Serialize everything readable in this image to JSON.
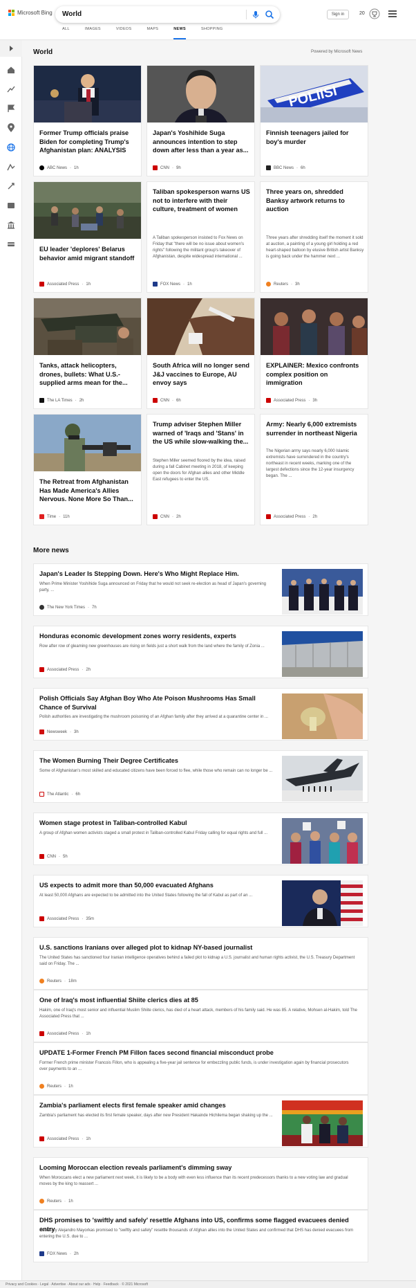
{
  "header": {
    "brand": "Microsoft Bing",
    "query": "World",
    "signin_label": "Sign in",
    "points": "20",
    "colors": {
      "red": "#f25022",
      "green": "#7fba00",
      "blue": "#00a4ef",
      "yellow": "#ffb900",
      "accent": "#1a73e8"
    }
  },
  "tabs": [
    "ALL",
    "IMAGES",
    "VIDEOS",
    "MAPS",
    "NEWS",
    "SHOPPING"
  ],
  "active_tab": "NEWS",
  "rail_icons": [
    "expand-icon",
    "home-icon",
    "trending-icon",
    "flag-icon",
    "location-icon",
    "globe-icon",
    "business-icon",
    "tech-icon",
    "entertainment-icon",
    "politics-icon",
    "money-icon"
  ],
  "section": {
    "title": "World",
    "powered": "Powered by Microsoft News"
  },
  "cards": [
    {
      "title": "Former Trump officials praise Biden for completing Trump's Afghanistan plan: ANALYSIS",
      "source": "ABC News",
      "age": "1h",
      "image": "photo"
    },
    {
      "title": "Japan's Yoshihide Suga announces intention to step down after less than a year as...",
      "source": "CNN",
      "age": "9h",
      "image": "photo"
    },
    {
      "title": "Finnish teenagers jailed for boy's murder",
      "source": "BBC News",
      "age": "6h",
      "image": "photo"
    },
    {
      "title": "EU leader 'deplores' Belarus behavior amid migrant standoff",
      "source": "Associated Press",
      "age": "1h",
      "image": "photo"
    },
    {
      "title": "Taliban spokesperson warns US not to interfere with their culture, treatment of women",
      "snippet": "A Taliban spokesperson insisted to Fox News on Friday that \"there will be no issue about women's rights\" following the militant group's takeover of Afghanistan, despite widespread international ...",
      "source": "FOX News",
      "age": "1h"
    },
    {
      "title": "Three years on, shredded Banksy artwork returns to auction",
      "snippet": "Three years after shredding itself the moment it sold at auction, a painting of a young girl holding a red heart-shaped balloon by elusive British artist Banksy is going back under the hammer next ...",
      "source": "Reuters",
      "age": "3h"
    },
    {
      "title": "Tanks, attack helicopters, drones, bullets: What U.S.-supplied arms mean for the...",
      "source": "The LA Times",
      "age": "2h",
      "image": "photo"
    },
    {
      "title": "South Africa will no longer send J&J vaccines to Europe, AU envoy says",
      "source": "CNN",
      "age": "6h",
      "image": "photo"
    },
    {
      "title": "EXPLAINER: Mexico confronts complex position on immigration",
      "source": "Associated Press",
      "age": "3h",
      "image": "photo"
    },
    {
      "title": "The Retreat from Afghanistan Has Made America's Allies Nervous. None More So Than...",
      "source": "Time",
      "age": "11h",
      "image": "photo"
    },
    {
      "title": "Trump adviser Stephen Miller warned of 'Iraqs and 'Stans' in the US while slow-walking the...",
      "snippet": "Stephen Miller seemed floored by the idea, raised during a fall Cabinet meeting in 2018, of keeping open the doors for Afghan allies and other Middle East refugees to enter the US.",
      "source": "CNN",
      "age": "2h"
    },
    {
      "title": "Army: Nearly 6,000 extremists surrender in northeast Nigeria",
      "snippet": "The Nigerian army says nearly 6,000 Islamic extremists have surrendered in the country's northeast in recent weeks, marking one of the largest defections since the 12-year insurgency began. The ...",
      "source": "Associated Press",
      "age": "2h"
    }
  ],
  "more_title": "More news",
  "rows": [
    {
      "title": "Japan's Leader Is Stepping Down. Here's Who Might Replace Him.",
      "snippet": "When Prime Minister Yoshihide Suga announced on Friday that he would not seek re-election as head of Japan's governing party, ...",
      "source": "The New York Times",
      "age": "7h"
    },
    {
      "title": "Honduras economic development zones worry residents, experts",
      "snippet": "Row after row of gleaming new greenhouses are rising on fields just a short walk from the land where the family of Zonia ...",
      "source": "Associated Press",
      "age": "2h"
    },
    {
      "title": "Polish Officials Say Afghan Boy Who Ate Poison Mushrooms Has Small Chance of Survival",
      "snippet": "Polish authorities are investigating the mushroom poisoning of an Afghan family after they arrived at a quarantine center in ...",
      "source": "Newsweek",
      "age": "3h"
    },
    {
      "title": "The Women Burning Their Degree Certificates",
      "snippet": "Some of Afghanistan's most skilled and educated citizens have been forced to flee, while those who remain can no longer be ...",
      "source": "The Atlantic",
      "age": "6h"
    },
    {
      "title": "Women stage protest in Taliban-controlled Kabul",
      "snippet": "A group of Afghan women activists staged a small protest in Taliban-controlled Kabul Friday calling for equal rights and full ...",
      "source": "CNN",
      "age": "5h"
    },
    {
      "title": "US expects to admit more than 50,000 evacuated Afghans",
      "snippet": "At least 50,000 Afghans are expected to be admitted into the United States following the fall of Kabul as part of an ...",
      "source": "Associated Press",
      "age": "35m"
    },
    {
      "title": "U.S. sanctions Iranians over alleged plot to kidnap NY-based journalist",
      "snippet": "The United States has sanctioned four Iranian intelligence operatives behind a failed plot to kidnap a U.S. journalist and human rights activist, the U.S. Treasury Department said on Friday. The ...",
      "source": "Reuters",
      "age": "18m"
    },
    {
      "title": "One of Iraq's most influential Shiite clerics dies at 85",
      "snippet": "Hakim, one of Iraq's most senior and influential Muslim Shiite clerics, has died of a heart attack, members of his family said. He was 85. A relative, Mohsen al-Hakim, told The Associated Press that ...",
      "source": "Associated Press",
      "age": "1h"
    },
    {
      "title": "UPDATE 1-Former French PM Fillon faces second financial misconduct probe",
      "snippet": "Former French prime minister Francois Fillon, who is appealing a five-year jail sentence for embezzling public funds, is under investigation again by financial prosecutors over payments to an ...",
      "source": "Reuters",
      "age": "1h"
    },
    {
      "title": "Zambia's parliament elects first female speaker amid changes",
      "snippet": "Zambia's parliament has elected its first female speaker, days after new President Hakainde Hichilema began shaking up the ...",
      "source": "Associated Press",
      "age": "1h"
    },
    {
      "title": "Looming Moroccan election reveals parliament's dimming sway",
      "snippet": "When Moroccans elect a new parliament next week, it is likely to be a body with even less influence than its recent predecessors thanks to a new voting law and gradual moves by the king to reassert ...",
      "source": "Reuters",
      "age": "1h"
    },
    {
      "title": "DHS promises to 'swiftly and safely' resettle Afghans into US, confirms some flagged evacuees denied entry",
      "snippet": "Secretary Alejandro Mayorkas promised to \"swiftly and safely\" resettle thousands of Afghan allies into the United States and confirmed that DHS has denied evacuees from entering the U.S. due to ...",
      "source": "FOX News",
      "age": "2h"
    }
  ],
  "footer_text": "Privacy and Cookies · Legal · Advertise · About our ads · Help · Feedback · © 2021 Microsoft"
}
